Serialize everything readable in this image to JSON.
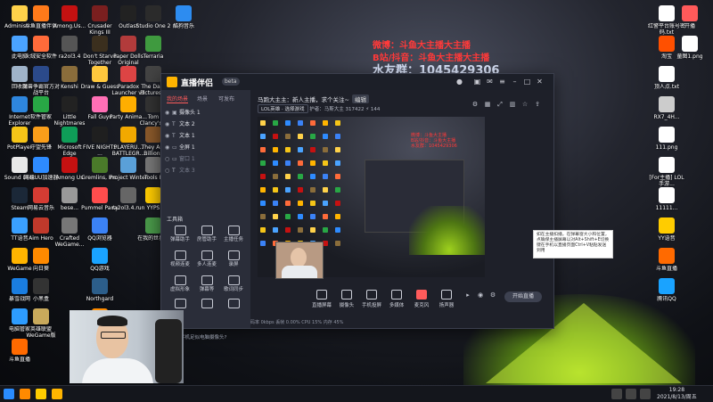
{
  "desktop": {
    "icons_left": [
      {
        "label": "Administr...",
        "color": "#ffd24a"
      },
      {
        "label": "此电脑",
        "color": "#4aa3ff"
      },
      {
        "label": "回收站",
        "color": "#9fb3c9"
      },
      {
        "label": "Internet Explorer",
        "color": "#2e86de"
      },
      {
        "label": "PotPlayer",
        "color": "#f5c518"
      },
      {
        "label": "Sound Lock",
        "color": "#e8e8e8"
      },
      {
        "label": "Steam",
        "color": "#1b2838"
      },
      {
        "label": "TT语音",
        "color": "#3aa0ff"
      },
      {
        "label": "WeGame",
        "color": "#ffb400"
      },
      {
        "label": "暴雪战网",
        "color": "#1a7de0"
      },
      {
        "label": "电脑管家",
        "color": "#2d9cff"
      },
      {
        "label": "斗鱼直播",
        "color": "#ff6a00"
      }
    ],
    "icons_col2": [
      {
        "label": "斗鱼直播伴侣",
        "color": "#ff7a1a"
      },
      {
        "label": "火绒安全软件",
        "color": "#ff6b3a"
      },
      {
        "label": "魔兽争霸官方对战平台",
        "color": "#2b4a8a"
      },
      {
        "label": "软件管家",
        "color": "#28a745"
      },
      {
        "label": "守望先锋",
        "color": "#f99e1a"
      },
      {
        "label": "网易UU加速器",
        "color": "#2e8bff"
      },
      {
        "label": "网易云音乐",
        "color": "#d43c33"
      },
      {
        "label": "Aim Hero",
        "color": "#c0392b"
      },
      {
        "label": "向日葵",
        "color": "#ff8a00"
      },
      {
        "label": "小黑盒",
        "color": "#333"
      },
      {
        "label": "英雄联盟WeGame版",
        "color": "#c8a95b"
      }
    ],
    "icons_col3": [
      {
        "label": "Among.Us...",
        "color": "#c51111"
      },
      {
        "label": "ra2ol3.4",
        "color": "#555"
      },
      {
        "label": "Kenshi",
        "color": "#8a6d3b"
      },
      {
        "label": "Little Nightmares",
        "color": "#222"
      },
      {
        "label": "Microsoft Edge",
        "color": "#0f9d58"
      },
      {
        "label": "Among Us",
        "color": "#c51111"
      },
      {
        "label": "bese...",
        "color": "#999"
      },
      {
        "label": "Crafted WeGame...",
        "color": "#777"
      }
    ],
    "icons_col4": [
      {
        "label": "Crusader Kings III",
        "color": "#7a1f1f"
      },
      {
        "label": "Don't Starve Together",
        "color": "#3b2f1e"
      },
      {
        "label": "Draw & Guess",
        "color": "#ffc83d"
      },
      {
        "label": "Fall Guys",
        "color": "#ff6fb5"
      },
      {
        "label": "FIVE NIGHTS ...",
        "color": "#1f1f1f"
      },
      {
        "label": "Gremlins, Inc.",
        "color": "#4a7a2a"
      },
      {
        "label": "Pummel Party",
        "color": "#ff4d4d"
      },
      {
        "label": "QQ浏览器",
        "color": "#3b82f6"
      },
      {
        "label": "QQ游戏",
        "color": "#1aa3ff"
      },
      {
        "label": "Northgard",
        "color": "#2c5e8a"
      },
      {
        "label": "腾手主播联盟",
        "color": "#ff8c00"
      }
    ],
    "icons_col5": [
      {
        "label": "Outlast",
        "color": "#222"
      },
      {
        "label": "Paper Dolls Original",
        "color": "#b23b3b"
      },
      {
        "label": "Paradox Launcher v2",
        "color": "#d44"
      },
      {
        "label": "Party Anima...",
        "color": "#ffae00"
      },
      {
        "label": "PLAYERU... BATTLEGR...",
        "color": "#f2a900"
      },
      {
        "label": "Project Winter",
        "color": "#5aa0d8"
      },
      {
        "label": "ra2ol3.4.run",
        "color": "#666"
      }
    ],
    "icons_col6": [
      {
        "label": "Studio One 2",
        "color": "#2b2b2b"
      },
      {
        "label": "Terraria",
        "color": "#3f9a3f"
      },
      {
        "label": "The Dark Pictures...",
        "color": "#444"
      },
      {
        "label": "Tom Clancy's...",
        "color": "#333"
      },
      {
        "label": "They Are Billions",
        "color": "#8b5a2b"
      },
      {
        "label": "Tools II",
        "color": "#777"
      },
      {
        "label": "YYPS",
        "color": "#ffcc00"
      },
      {
        "label": "在我的世界...",
        "color": "#4a9a4a"
      }
    ],
    "icons_col7": [
      {
        "label": "酷狗音乐",
        "color": "#2d8cf0"
      }
    ],
    "icons_right": [
      {
        "label": "红警平台账号密码.txt",
        "color": "#ffffff"
      },
      {
        "label": "淘宝",
        "color": "#ff5000"
      },
      {
        "label": "顶人点.txt",
        "color": "#ffffff"
      },
      {
        "label": "RX7_4H...",
        "color": "#cccccc"
      },
      {
        "label": "111.png",
        "color": "#ffffff"
      },
      {
        "label": "[For主播] LOL手游...",
        "color": "#ffffff"
      },
      {
        "label": "11111...",
        "color": "#ffffff"
      },
      {
        "label": "YY语音",
        "color": "#ffcc00"
      },
      {
        "label": "斗鱼直播",
        "color": "#ff6a00"
      },
      {
        "label": "腾讯QQ",
        "color": "#1aa3ff"
      }
    ],
    "icons_right2": [
      {
        "label": "开播",
        "color": "#ff5a5a"
      },
      {
        "label": "童图1.png",
        "color": "#ffffff"
      }
    ],
    "overlay_lines": [
      "微博：斗鱼大主播大主播",
      "B站/抖音：斗鱼大主播大主播"
    ],
    "overlay_qq": "水友群：1045429306"
  },
  "app": {
    "name": "直播伴侣",
    "version": "beta",
    "tabs": [
      "我的场景",
      "场景",
      "可发布"
    ],
    "sources": [
      {
        "label": "摄像头 1",
        "visible": true
      },
      {
        "label": "文本 2",
        "visible": true
      },
      {
        "label": "文本 1",
        "visible": true
      },
      {
        "label": "全屏 1",
        "visible": true
      },
      {
        "label": "窗口 1",
        "visible": false
      },
      {
        "label": "文本 3",
        "visible": false
      }
    ],
    "tools_title": "工具箱",
    "tools": [
      [
        "弹幕助手",
        "房管助手",
        "主播任务"
      ],
      [
        "视频连麦",
        "多人连麦",
        "录屏"
      ],
      [
        "虚拟形象",
        "弹幕等",
        "歌词同步"
      ],
      [
        "",
        "",
        ""
      ]
    ],
    "bottom_tip": "使用手机足似电脑摄像头?",
    "stream_title": "马跑大主主：新人主播，求个关注~",
    "edit_button": "编辑",
    "category": "LOL英雄 · 选择游戏",
    "stats": "护者：马斯大主 317422   ⚡ 144",
    "controls": [
      "直播屏幕",
      "摄像头",
      "手机投屏",
      "多媒体",
      "麦克风",
      "扬声器"
    ],
    "go_live": "开始直播",
    "status": "码率 0kbps    丢帧 0.00%    CPU 15%    内存 45%",
    "preview_red": [
      "微博：斗鱼大主播",
      "B站/抖音：斗鱼大主播",
      "水友群：1045429306"
    ]
  },
  "tooltip": {
    "text": "如在主播扣播，在弹幕窗大小和位置，点确保主播屏幕以对Alt+Shift+E切换键在手机以直播页面Ctrl+V粘贴发送到用"
  },
  "taskbar": {
    "time": "19:28",
    "date": "2021/8/13/周五"
  }
}
